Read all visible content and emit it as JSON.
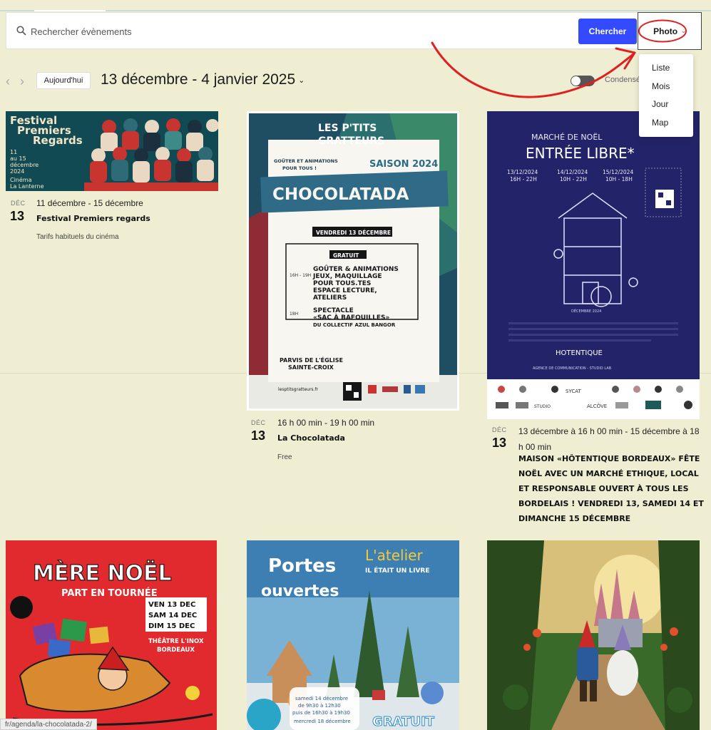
{
  "search": {
    "placeholder": "Rechercher évènements",
    "button_label": "Chercher",
    "view_label": "Photo"
  },
  "view_options": [
    "Liste",
    "Mois",
    "Jour",
    "Map"
  ],
  "toolbar": {
    "today_label": "Aujourd'hui",
    "date_range": "13 décembre - 4 janvier 2025",
    "condense_label": "Condensé",
    "condense_on": false
  },
  "events": [
    {
      "month": "DÉC",
      "day": "13",
      "time": "11 décembre - 15 décembre",
      "title": "Festival Premiers regards",
      "price": "Tarifs habituels du cinéma",
      "poster": {
        "lines": [
          "Festival",
          "Premiers",
          "Regards"
        ],
        "dates": [
          "11",
          "au 15",
          "décembre",
          "2024"
        ],
        "venue": [
          "Cinéma",
          "La Lanterne"
        ]
      }
    },
    {
      "month": "DÉC",
      "day": "13",
      "time": "16 h 00 min - 19 h 00 min",
      "title": "La Chocolatada",
      "price": "Free",
      "poster": {
        "brand": [
          "LES P'TITS",
          "GRATTEURS"
        ],
        "tagline": [
          "GOÛTER ET ANIMATIONS",
          "POUR TOUS !"
        ],
        "season": "SAISON 2024",
        "headline": "CHOCOLATADA",
        "date_banner": "VENDREDI 13 DÉCEMBRE",
        "free": "GRATUIT",
        "program_a": [
          "GOÛTER & ANIMATIONS",
          "JEUX, MAQUILLAGE",
          "POUR TOUS.TES",
          "ESPACE LECTURE,",
          "ATELIERS"
        ],
        "time_a": "16H - 19H",
        "program_b": [
          "SPECTACLE",
          "«SAC À BAFOUILLES»",
          "DU COLLECTIF AZUL BANGOR"
        ],
        "time_b": "18H",
        "place": [
          "PARVIS DE L'ÉGLISE",
          "SAINTE-CROIX"
        ],
        "site": "lesptitsgratteurs.fr"
      }
    },
    {
      "month": "DÉC",
      "day": "13",
      "time": "13 décembre à 16 h 00 min - 15 décembre à 18 h 00 min",
      "title": "MAISON «HÔTENTIQUE BORDEAUX» FÊTE NOËL AVEC UN MARCHÉ ETHIQUE, LOCAL ET RESPONSABLE OUVERT À TOUS LES BORDELAIS ! VENDREDI 13, SAMEDI 14 ET DIMANCHE 15 DÉCEMBRE",
      "price": "",
      "poster": {
        "top": "MARCHÉ DE NOËL",
        "headline": "ENTRÉE LIBRE*",
        "dates": [
          "13/12/2024",
          "14/12/2024",
          "15/12/2024"
        ],
        "hours": [
          "16H - 22H",
          "10H - 22H",
          "10H - 18H"
        ],
        "brand": "HOTENTIQUE",
        "agency": "AGENCE DE COMMUNICATION - STUDIO LAB",
        "sponsors": [
          "SYCAT",
          "ALCÔVE",
          "STUDIO"
        ]
      }
    },
    {
      "poster": {
        "headline": "MÈRE NOËL",
        "sub": "PART EN TOURNÉE",
        "dates": [
          "VEN 13 DEC",
          "SAM 14 DEC",
          "DIM 15 DEC"
        ],
        "venue": [
          "THÉÂTRE L'INOX",
          "BORDEAUX"
        ]
      }
    },
    {
      "poster": {
        "headline": [
          "Portes",
          "ouvertes"
        ],
        "brand": [
          "L'atelier",
          "IL ÉTAIT UN LIVRE"
        ],
        "dates": [
          "samedi 14 décembre",
          "de 9h30 à 12h30",
          "puis de 16h30 à 19h30",
          "mercredi 18 décembre"
        ],
        "free": "GRATUIT"
      }
    },
    {
      "poster": {}
    }
  ],
  "status_url": "fr/agenda/la-chocolatada-2/",
  "colors": {
    "page_bg": "#efedd2",
    "accent": "#334aff",
    "annotation": "#e02020"
  }
}
